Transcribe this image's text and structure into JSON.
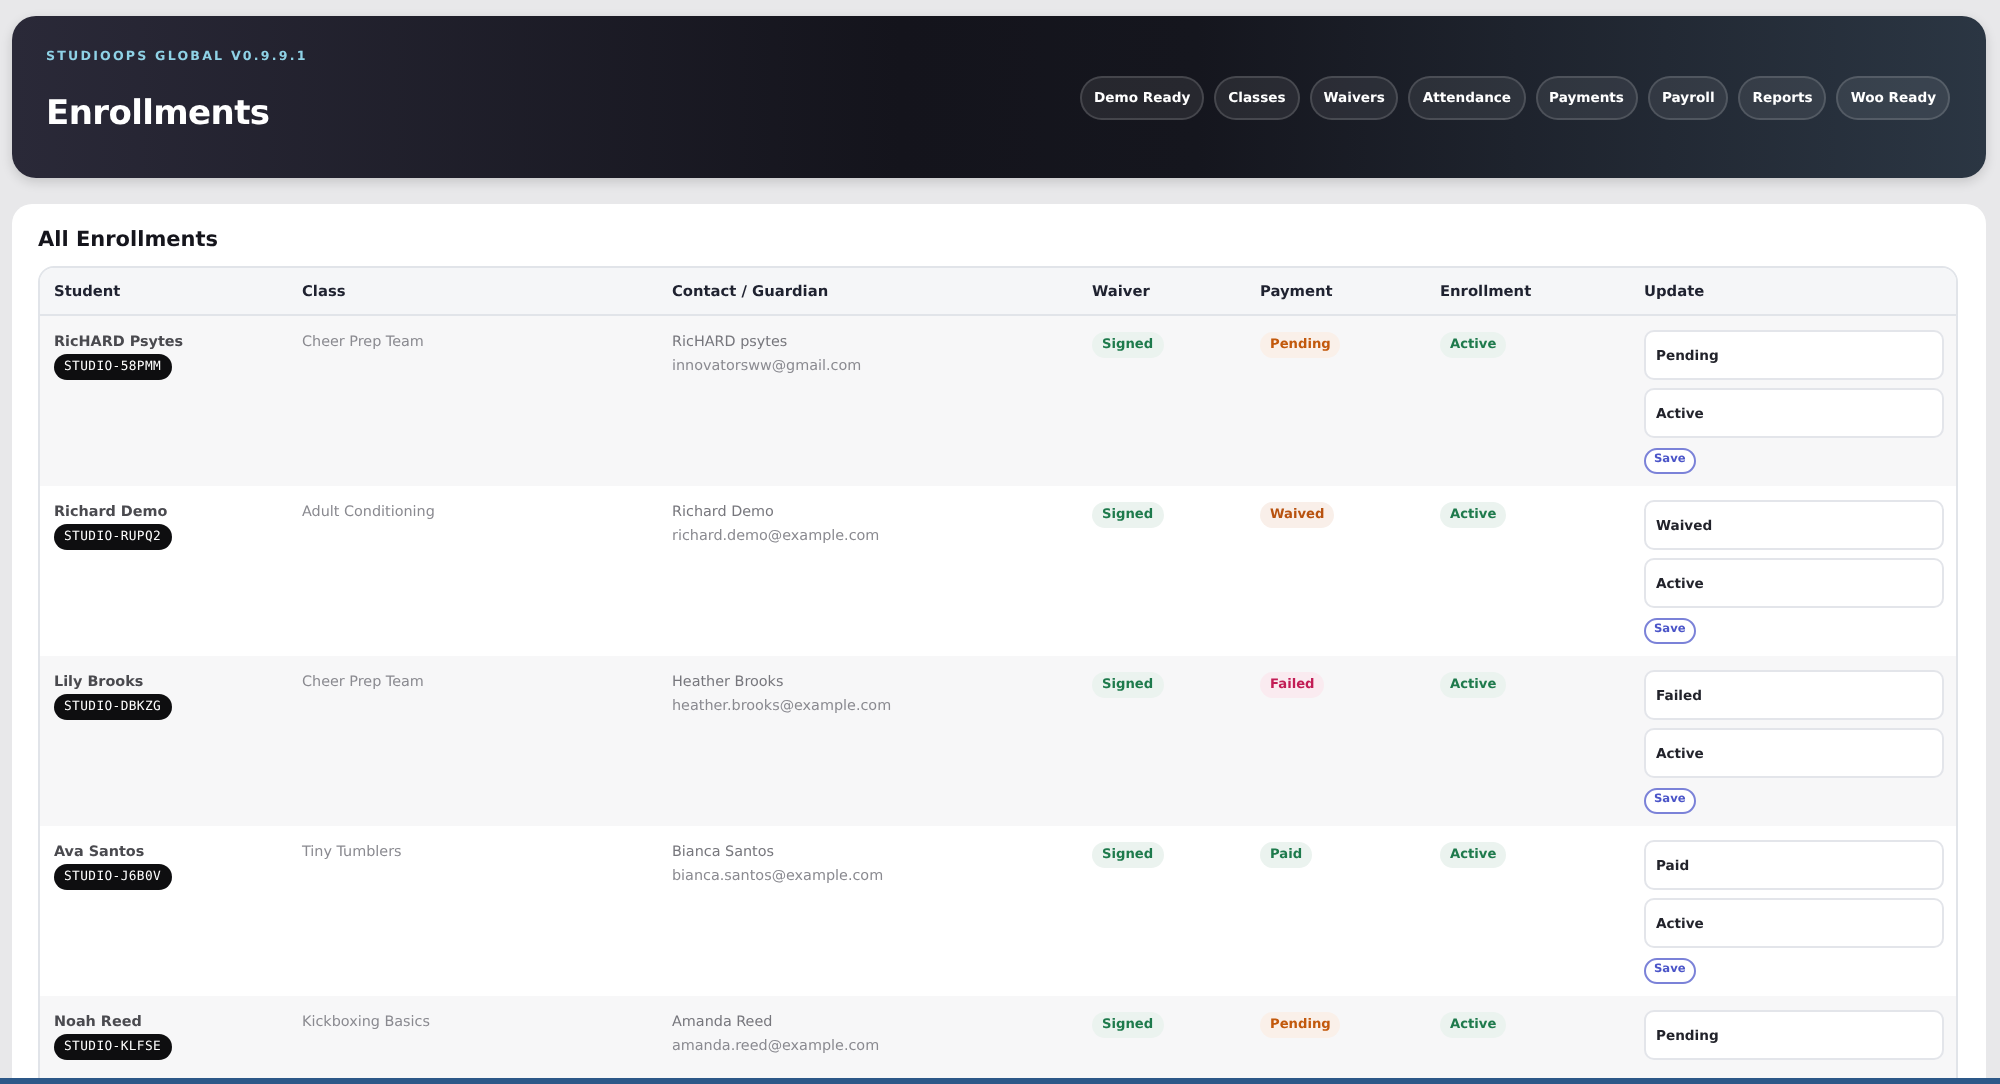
{
  "header": {
    "eyebrow": "STUDIOOPS GLOBAL V0.9.9.1",
    "title": "Enrollments",
    "nav": [
      "Demo Ready",
      "Classes",
      "Waivers",
      "Attendance",
      "Payments",
      "Payroll",
      "Reports",
      "Woo Ready"
    ]
  },
  "section": {
    "title": "All Enrollments",
    "columns": [
      "Student",
      "Class",
      "Contact / Guardian",
      "Waiver",
      "Payment",
      "Enrollment",
      "Update"
    ],
    "rows": [
      {
        "student": "RicHARD Psytes",
        "student_id": "STUDIO-58PMM",
        "class": "Cheer Prep Team",
        "guardian": "RicHARD psytes",
        "email": "innovatorsww@gmail.com",
        "waiver": {
          "text": "Signed",
          "color": "#1e7a4c"
        },
        "payment": {
          "text": "Pending",
          "color": "#c2590c"
        },
        "enrollment": {
          "text": "Active",
          "color": "#1e7a4c"
        },
        "update": {
          "payment": "Pending",
          "enrollment": "Active",
          "button": "Save"
        }
      },
      {
        "student": "Richard Demo",
        "student_id": "STUDIO-RUPQ2",
        "class": "Adult Conditioning",
        "guardian": "Richard Demo",
        "email": "richard.demo@example.com",
        "waiver": {
          "text": "Signed",
          "color": "#1e7a4c"
        },
        "payment": {
          "text": "Waived",
          "color": "#b8520f"
        },
        "enrollment": {
          "text": "Active",
          "color": "#1e7a4c"
        },
        "update": {
          "payment": "Waived",
          "enrollment": "Active",
          "button": "Save"
        }
      },
      {
        "student": "Lily Brooks",
        "student_id": "STUDIO-DBKZG",
        "class": "Cheer Prep Team",
        "guardian": "Heather Brooks",
        "email": "heather.brooks@example.com",
        "waiver": {
          "text": "Signed",
          "color": "#1e7a4c"
        },
        "payment": {
          "text": "Failed",
          "color": "#c21d55"
        },
        "enrollment": {
          "text": "Active",
          "color": "#1e7a4c"
        },
        "update": {
          "payment": "Failed",
          "enrollment": "Active",
          "button": "Save"
        }
      },
      {
        "student": "Ava Santos",
        "student_id": "STUDIO-J6B0V",
        "class": "Tiny Tumblers",
        "guardian": "Bianca Santos",
        "email": "bianca.santos@example.com",
        "waiver": {
          "text": "Signed",
          "color": "#1e7a4c"
        },
        "payment": {
          "text": "Paid",
          "color": "#1e7a4c"
        },
        "enrollment": {
          "text": "Active",
          "color": "#1e7a4c"
        },
        "update": {
          "payment": "Paid",
          "enrollment": "Active",
          "button": "Save"
        }
      },
      {
        "student": "Noah Reed",
        "student_id": "STUDIO-KLFSE",
        "class": "Kickboxing Basics",
        "guardian": "Amanda Reed",
        "email": "amanda.reed@example.com",
        "waiver": {
          "text": "Signed",
          "color": "#1e7a4c"
        },
        "payment": {
          "text": "Pending",
          "color": "#c2590c"
        },
        "enrollment": {
          "text": "Active",
          "color": "#1e7a4c"
        },
        "update": {
          "payment": "Pending"
        }
      }
    ]
  }
}
